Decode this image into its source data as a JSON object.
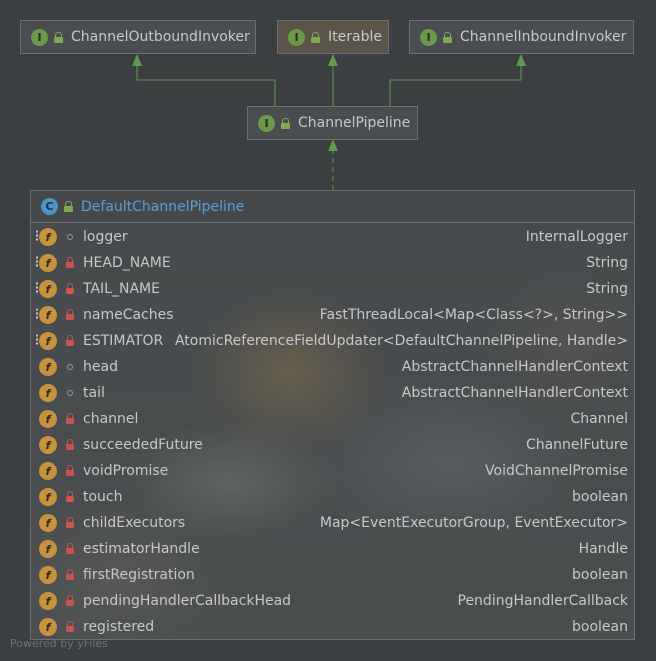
{
  "interfaces": [
    {
      "name": "ChannelOutboundInvoker",
      "kind": "I"
    },
    {
      "name": "Iterable",
      "kind": "I"
    },
    {
      "name": "ChannelInboundInvoker",
      "kind": "I"
    }
  ],
  "pipeline": {
    "name": "ChannelPipeline",
    "kind": "I"
  },
  "class_node": {
    "name": "DefaultChannelPipeline",
    "kind": "C",
    "fields": [
      {
        "name": "logger",
        "type": "InternalLogger",
        "static": true,
        "visibility": "package"
      },
      {
        "name": "HEAD_NAME",
        "type": "String",
        "static": true,
        "visibility": "private"
      },
      {
        "name": "TAIL_NAME",
        "type": "String",
        "static": true,
        "visibility": "private"
      },
      {
        "name": "nameCaches",
        "type": "FastThreadLocal<Map<Class<?>, String>>",
        "static": true,
        "visibility": "private"
      },
      {
        "name": "ESTIMATOR",
        "type": "AtomicReferenceFieldUpdater<DefaultChannelPipeline, Handle>",
        "static": true,
        "visibility": "private"
      },
      {
        "name": "head",
        "type": "AbstractChannelHandlerContext",
        "static": false,
        "visibility": "package"
      },
      {
        "name": "tail",
        "type": "AbstractChannelHandlerContext",
        "static": false,
        "visibility": "package"
      },
      {
        "name": "channel",
        "type": "Channel",
        "static": false,
        "visibility": "private"
      },
      {
        "name": "succeededFuture",
        "type": "ChannelFuture",
        "static": false,
        "visibility": "private"
      },
      {
        "name": "voidPromise",
        "type": "VoidChannelPromise",
        "static": false,
        "visibility": "private"
      },
      {
        "name": "touch",
        "type": "boolean",
        "static": false,
        "visibility": "private"
      },
      {
        "name": "childExecutors",
        "type": "Map<EventExecutorGroup, EventExecutor>",
        "static": false,
        "visibility": "private"
      },
      {
        "name": "estimatorHandle",
        "type": "Handle",
        "static": false,
        "visibility": "private"
      },
      {
        "name": "firstRegistration",
        "type": "boolean",
        "static": false,
        "visibility": "private"
      },
      {
        "name": "pendingHandlerCallbackHead",
        "type": "PendingHandlerCallback",
        "static": false,
        "visibility": "private"
      },
      {
        "name": "registered",
        "type": "boolean",
        "static": false,
        "visibility": "private"
      }
    ]
  },
  "footer": "Powered by yFiles",
  "colors": {
    "edge": "#5d9b4f",
    "interface_badge": "#6a9a47",
    "class_badge": "#4b94c8",
    "field_icon": "#c7923c",
    "class_name": "#5a9fd4"
  }
}
